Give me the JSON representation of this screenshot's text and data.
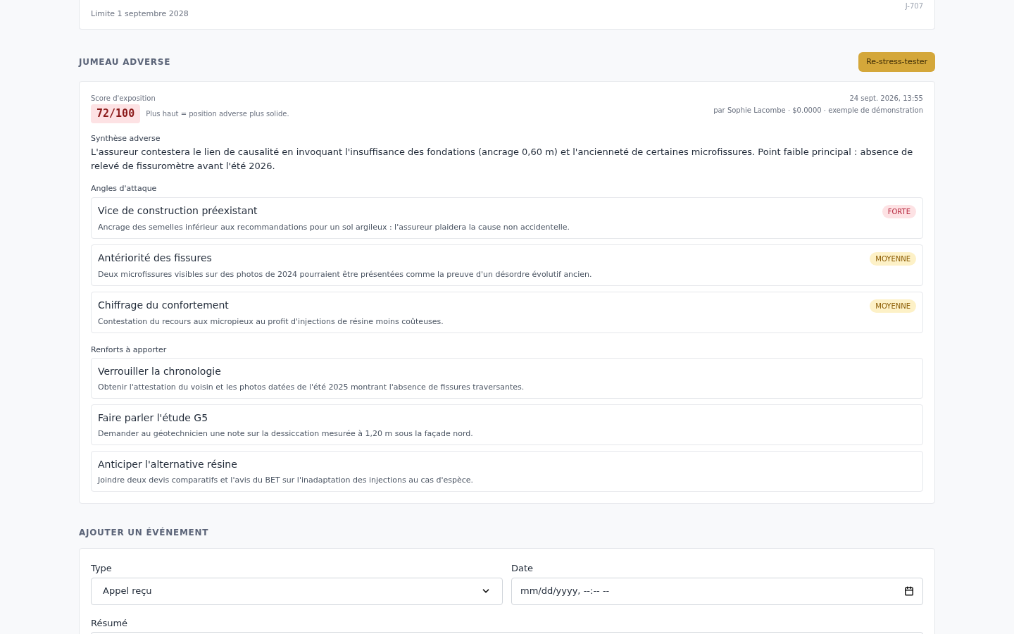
{
  "deadline_card": {
    "deadline": "Limite 1 septembre 2028",
    "countdown": "J-707"
  },
  "adverse_twin": {
    "title": "JUMEAU ADVERSE",
    "retest_button": "Re-stress-tester",
    "score_label": "Score d'exposition",
    "score": "72/100",
    "score_hint": "Plus haut = position adverse plus solide.",
    "date": "24 sept. 2026, 13:55",
    "meta": "par Sophie Lacombe · $0.0000 · exemple de démonstration",
    "summary_label": "Synthèse adverse",
    "summary": "L'assureur contestera le lien de causalité en invoquant l'insuffisance des fondations (ancrage 0,60 m) et l'ancienneté de certaines microfissures. Point faible principal : absence de relevé de fissuromètre avant l'été 2026.",
    "angles_label": "Angles d'attaque",
    "angles": [
      {
        "title": "Vice de construction préexistant",
        "text": "Ancrage des semelles inférieur aux recommandations pour un sol argileux : l'assureur plaidera la cause non accidentelle.",
        "badge": "FORTE",
        "kind": "high"
      },
      {
        "title": "Antériorité des fissures",
        "text": "Deux microfissures visibles sur des photos de 2024 pourraient être présentées comme la preuve d'un désordre évolutif ancien.",
        "badge": "MOYENNE",
        "kind": "medium"
      },
      {
        "title": "Chiffrage du confortement",
        "text": "Contestation du recours aux micropieux au profit d'injections de résine moins coûteuses.",
        "badge": "MOYENNE",
        "kind": "medium"
      }
    ],
    "reinforcements_label": "Renforts à apporter",
    "reinforcements": [
      {
        "title": "Verrouiller la chronologie",
        "text": "Obtenir l'attestation du voisin et les photos datées de l'été 2025 montrant l'absence de fissures traversantes."
      },
      {
        "title": "Faire parler l'étude G5",
        "text": "Demander au géotechnicien une note sur la dessiccation mesurée à 1,20 m sous la façade nord."
      },
      {
        "title": "Anticiper l'alternative résine",
        "text": "Joindre deux devis comparatifs et l'avis du BET sur l'inadaptation des injections au cas d'espèce."
      }
    ]
  },
  "add_event": {
    "title": "AJOUTER UN ÉVÉNEMENT",
    "type_label": "Type",
    "type_value": "Appel reçu",
    "date_label": "Date",
    "date_placeholder": "mm/dd/yyyy, --:-- --",
    "summary_label": "Résumé"
  }
}
